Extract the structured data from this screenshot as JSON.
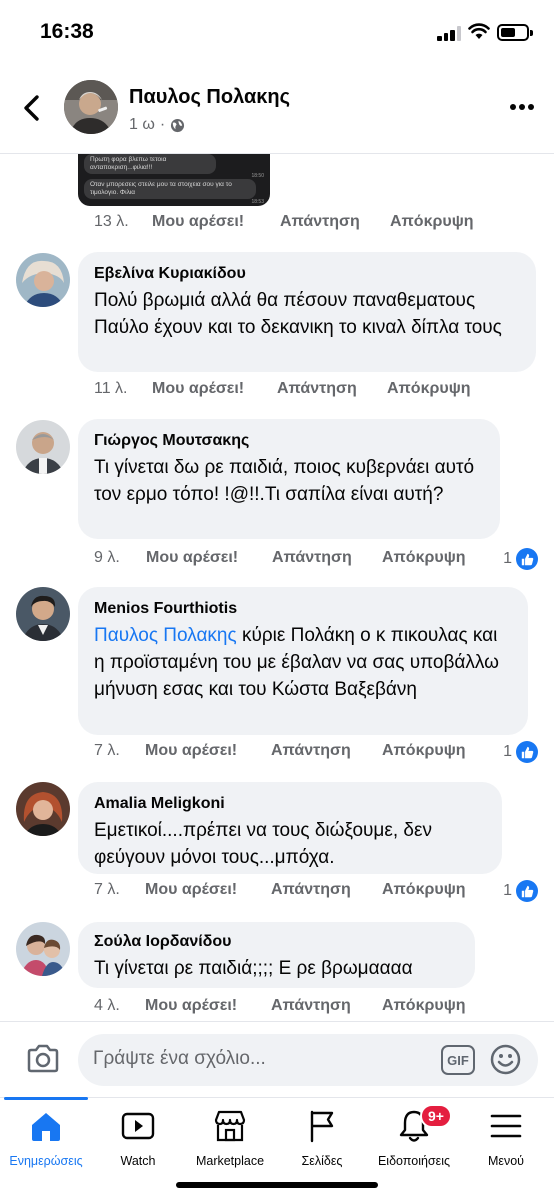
{
  "status_bar": {
    "time": "16:38",
    "battery_level": 0.55
  },
  "post": {
    "author": "Παυλος Πολακης",
    "time": "1 ω",
    "separator": "·",
    "audience_icon": "globe-icon"
  },
  "screenshot_attachment": {
    "messages": [
      "Πρωτη φορα βλεπω τετοια ανταποκριση...φιλια!!!",
      "Οταν μπορεσεις στειλε μου τα στοιχεια σου για το τιμολογιο. Φιλια"
    ],
    "times": [
      "18:50",
      "18:53"
    ]
  },
  "actions": {
    "like": "Μου αρέσει!",
    "reply": "Απάντηση",
    "hide": "Απόκρυψη"
  },
  "first_row_time": "13 λ.",
  "comments": [
    {
      "author": "Εβελίνα Κυριακίδου",
      "text": "Πολύ βρωμιά αλλά θα πέσουν παναθεματους Παύλο έχουν και το δεκανικη το κιναλ δίπλα τους",
      "time": "11 λ.",
      "reactions": ""
    },
    {
      "author": "Γιώργος Μουτσακης",
      "text": "Τι γίνεται δω ρε παιδιά, ποιος κυβερνάει αυτό τον ερμο τόπο! !@!!.Τι σαπίλα είναι αυτή?",
      "time": "9 λ.",
      "reactions": "1"
    },
    {
      "author": "Menios Fourthiotis",
      "mention": "Παυλος Πολακης",
      "text": "κύριε Πολάκη ο κ πικουλας και η προϊσταμένη του με έβαλαν να σας υποβάλλω μήνυση εσας και του Κώστα Βαξεβάνη",
      "time": "7 λ.",
      "reactions": "1"
    },
    {
      "author": "Amalia Meligkoni",
      "text": "Εμετικοί....πρέπει να τους διώξουμε, δεν φεύγουν μόνοι τους...μπόχα.",
      "time": "7 λ.",
      "reactions": "1"
    },
    {
      "author": "Σούλα Ιορδανίδου",
      "text": "Τι γίνεται ρε παιδιά;;;; Ε ρε βρωμαααα",
      "time": "4 λ.",
      "reactions": ""
    }
  ],
  "composer": {
    "placeholder": "Γράψτε ένα σχόλιο...",
    "gif_label": "GIF"
  },
  "tabs": [
    {
      "label": "Ενημερώσεις",
      "icon": "home-icon",
      "active": true
    },
    {
      "label": "Watch",
      "icon": "watch-icon"
    },
    {
      "label": "Marketplace",
      "icon": "marketplace-icon"
    },
    {
      "label": "Σελίδες",
      "icon": "flag-icon"
    },
    {
      "label": "Ειδοποιήσεις",
      "icon": "bell-icon",
      "badge": "9+"
    },
    {
      "label": "Μενού",
      "icon": "menu-icon"
    }
  ],
  "colors": {
    "accent": "#1877f2",
    "badge": "#e41e3f",
    "bubble": "#f0f2f5",
    "secondary_text": "#65676b"
  }
}
